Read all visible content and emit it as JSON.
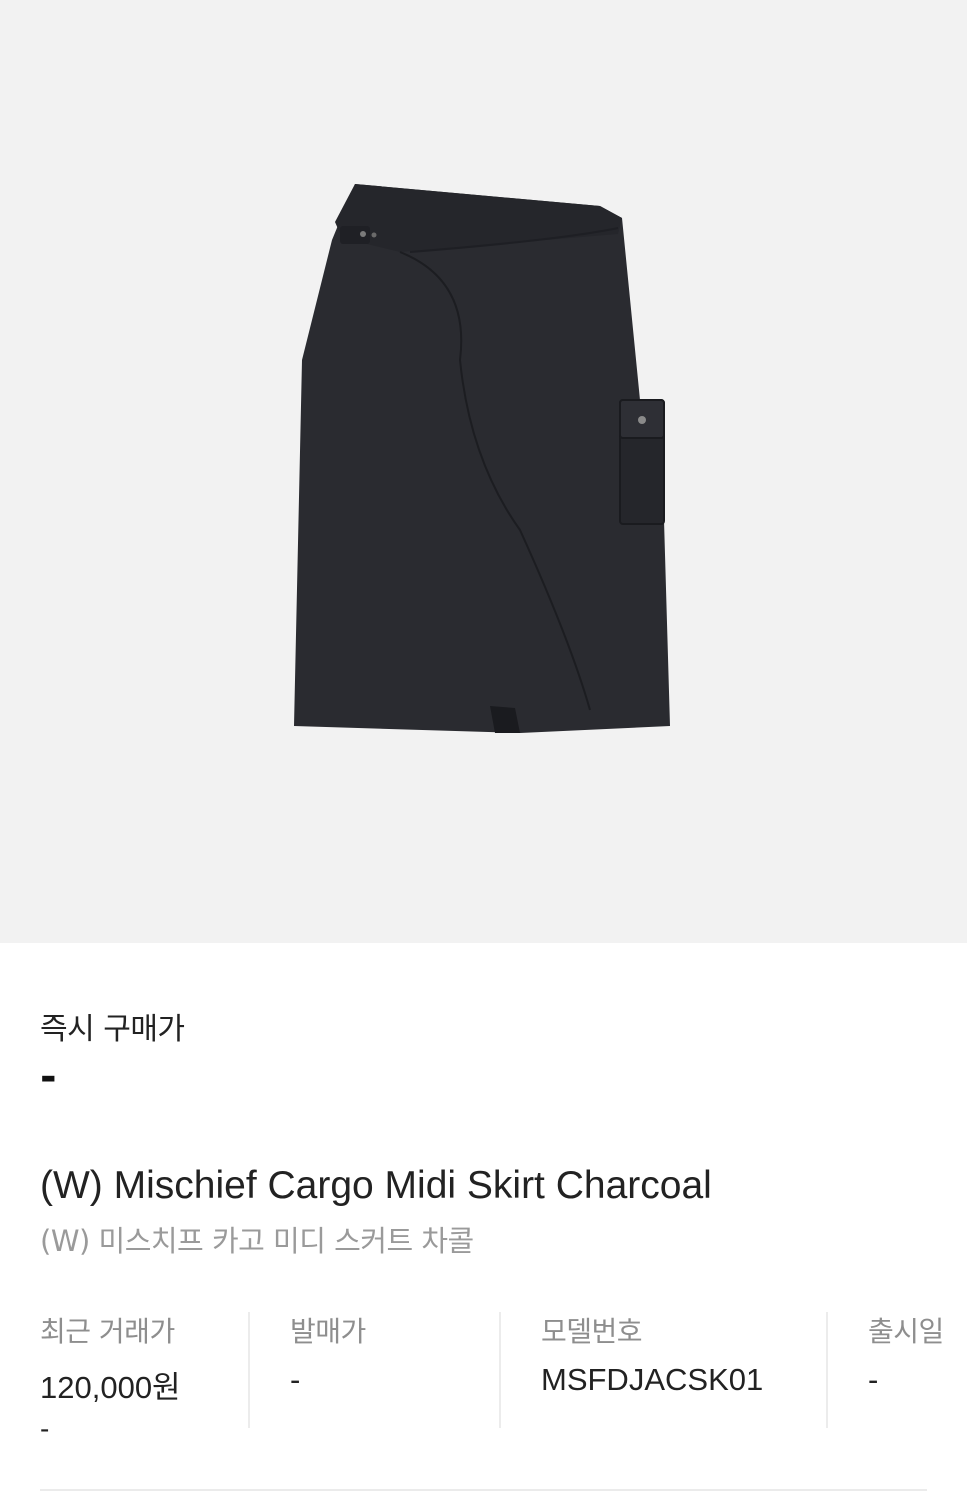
{
  "product": {
    "image_icon": "skirt-product-image",
    "instant_buy_label": "즉시 구매가",
    "instant_buy_value": "-",
    "title_en": "(W) Mischief Cargo Midi Skirt Charcoal",
    "title_ko": "(W) 미스치프 카고 미디 스커트 차콜"
  },
  "details": {
    "recent_price": {
      "label": "최근 거래가",
      "value": "120,000원",
      "change": "-"
    },
    "release_price": {
      "label": "발매가",
      "value": "-"
    },
    "model_number": {
      "label": "모델번호",
      "value": "MSFDJACSK01"
    },
    "release_date": {
      "label": "출시일",
      "value": "-"
    }
  },
  "colors": {
    "image_background": "#f2f2f2",
    "skirt": "#2a2b30",
    "label_gray": "#8e8e8e"
  }
}
